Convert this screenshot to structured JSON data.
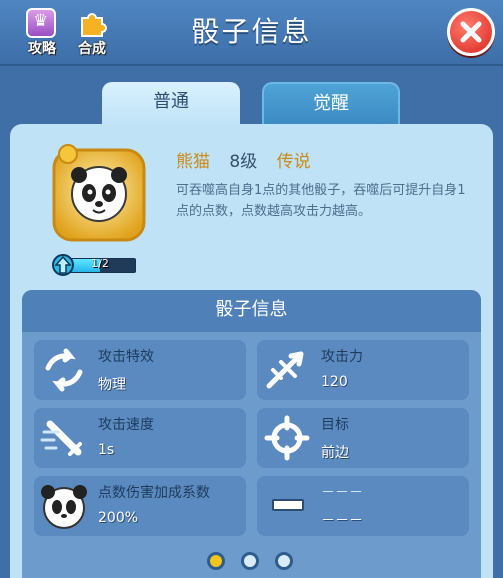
{
  "header": {
    "title": "骰子信息",
    "guide_label": "攻略",
    "merge_label": "合成"
  },
  "tabs": [
    {
      "label": "普通",
      "active": true
    },
    {
      "label": "觉醒",
      "active": false
    }
  ],
  "dice": {
    "name": "熊猫",
    "level": "8级",
    "rarity": "传说",
    "description": "可吞噬高自身1点的其他骰子，吞噬后可提升自身1点的点数，点数越高攻击力越高。",
    "progress_text": "1/2",
    "progress_fraction": 0.5
  },
  "info": {
    "title": "骰子信息",
    "stats": [
      {
        "key": "攻击特效",
        "value": "物理",
        "icon": "attack-effect-icon"
      },
      {
        "key": "攻击力",
        "value": "120",
        "icon": "attack-power-icon"
      },
      {
        "key": "攻击速度",
        "value": "1s",
        "icon": "attack-speed-icon"
      },
      {
        "key": "目标",
        "value": "前边",
        "icon": "target-icon"
      },
      {
        "key": "点数伤害加成系数",
        "value": "200%",
        "icon": "panda-icon"
      },
      {
        "key": "－－－",
        "value": "－－－",
        "icon": "bar-icon"
      }
    ]
  },
  "pagination": {
    "pages": 3,
    "current": 1
  },
  "colors": {
    "accent_gold": "#c98b1a",
    "close_red": "#d9281f",
    "dot_active": "#f3c419",
    "dot_inactive": "#d8ecf8"
  }
}
